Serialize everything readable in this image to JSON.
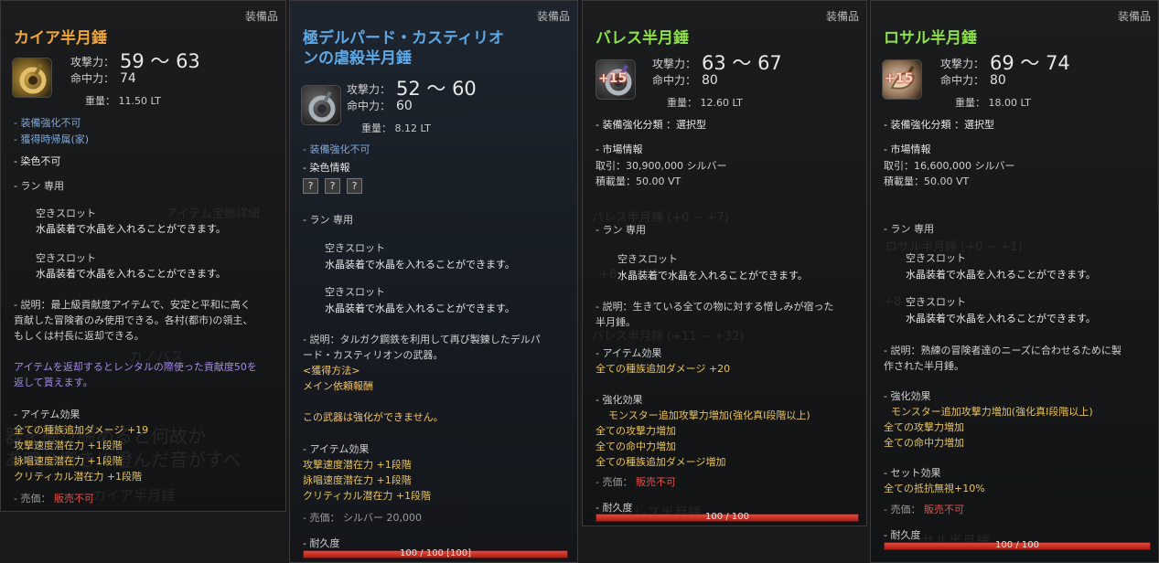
{
  "category": "装備品",
  "labels": {
    "attack": "攻撃力：",
    "accuracy": "命中力：",
    "weight": "重量："
  },
  "panels": [
    {
      "name": "カイア半月錘",
      "attack": "59 ～ 63",
      "accuracy": "74",
      "weight": "11.50 LT",
      "lines": [
        "- 装備強化不可",
        "- 獲得時帰属(家)",
        "- 染色不可",
        "- ラン 専用",
        "空きスロット",
        "水晶装着で水晶を入れることができます。",
        "空きスロット",
        "水晶装着で水晶を入れることができます。",
        "- 説明：最上級貢献度アイテムで、安定と平和に高く",
        "貢献した冒険者のみ使用できる。各村(都市)の領主、",
        "もしくは村長に返却できる。",
        "アイテムを返却するとレンタルの際使った貢献度50を",
        "返して貰えます。",
        "- アイテム効果",
        "全ての種族追加ダメージ +19",
        "攻撃速度潜在力 +1段階",
        "詠唱速度潜在力 +1段階",
        "クリティカル潜在力 +1段階",
        "- 売価：",
        "販売不可"
      ],
      "ghost": [
        "アイテム宝飾詳細",
        "カノバス",
        "器を握り締めると何故か",
        "あ鳴り響きに澄んだ音がすべ",
        "詠唱速度潜在力",
        "カイア半月錘"
      ]
    },
    {
      "name": "極デルパード・カスティリオンの虐殺半月錘",
      "name_lines": [
        "極デルパード・カスティリオ",
        "ンの虐殺半月錘"
      ],
      "attack": "52 ～ 60",
      "accuracy": "60",
      "weight": "8.12 LT",
      "dye_boxes": [
        "?",
        "?",
        "?"
      ],
      "lines": [
        "- 装備強化不可",
        "- 染色情報",
        "- ラン 専用",
        "空きスロット",
        "水晶装着で水晶を入れることができます。",
        "空きスロット",
        "水晶装着で水晶を入れることができます。",
        "- 説明：タルガク鋼鉄を利用して再び製錬したデルパ",
        "ード・カスティリオンの武器。",
        "<獲得方法>",
        "メイン依頼報酬",
        "この武器は強化ができません。",
        "- アイテム効果",
        "攻撃速度潜在力 +1段階",
        "詠唱速度潜在力 +1段階",
        "クリティカル潜在力 +1段階",
        "- 売価： シルバー 20,000",
        "- 耐久度"
      ],
      "durability": "100 / 100 [100]",
      "durability_ratio": 1.0
    },
    {
      "name": "バレス半月錘",
      "enhance": "+15",
      "attack": "63 ～ 67",
      "accuracy": "80",
      "weight": "12.60 LT",
      "lines": [
        "- 装備強化分類 ：選択型",
        "- 市場情報",
        "取引：30,900,000 シルバー",
        "積載量：50.00 VT",
        "- ラン 専用",
        "空きスロット",
        "水晶装着で水晶を入れることができます。",
        "- 説明：生きている全ての物に対する憎しみが宿った",
        "半月錘。",
        "- アイテム効果",
        "全ての種族追加ダメージ +20",
        "- 強化効果",
        "モンスター追加攻撃力増加(強化真I段階以上)",
        "全ての攻撃力増加",
        "全ての命中力増加",
        "全ての種族追加ダメージ増加",
        "- 売価：",
        "販売不可",
        "- 耐久度"
      ],
      "durability": "100 / 100",
      "durability_ratio": 1.0,
      "ghost": [
        "バレス半月錘 (+0 ~ +7)",
        "+8 ~ +10",
        "バレス半月錘 (+11 ~ +32)",
        "バレス半月錘"
      ]
    },
    {
      "name": "ロサル半月錘",
      "enhance": "+15",
      "attack": "69 ～ 74",
      "accuracy": "80",
      "weight": "18.00 LT",
      "lines": [
        "- 装備強化分類 ：選択型",
        "- 市場情報",
        "取引：16,600,000 シルバー",
        "積載量：50.00 VT",
        "- ラン 専用",
        "空きスロット",
        "水晶装着で水晶を入れることができます。",
        "空きスロット",
        "水晶装着で水晶を入れることができます。",
        "- 説明：熟練の冒険者達のニーズに合わせるために製",
        "作された半月錘。",
        "- 強化効果",
        "モンスター追加攻撃力増加(強化真I段階以上)",
        "全ての攻撃力増加",
        "全ての命中力増加",
        "- セット効果",
        "全ての抵抗無視+10%",
        "- 売価：",
        "販売不可",
        "- 耐久度"
      ],
      "durability": "100 / 100",
      "durability_ratio": 1.0,
      "ghost": [
        "ロサル半月錘 (+0 ~ +1)",
        "+8 ~ +10",
        "ロサル半月錘"
      ]
    }
  ],
  "colors": {
    "orange_name": "#f0a53c",
    "blue_name": "#5da8e6",
    "green_name": "#8ee04a",
    "effect_yellow": "#e8c35a",
    "unsellable_red": "#e0524a",
    "durability_red": "#d1362a"
  },
  "icons": [
    "half-moon-mace-icon"
  ]
}
